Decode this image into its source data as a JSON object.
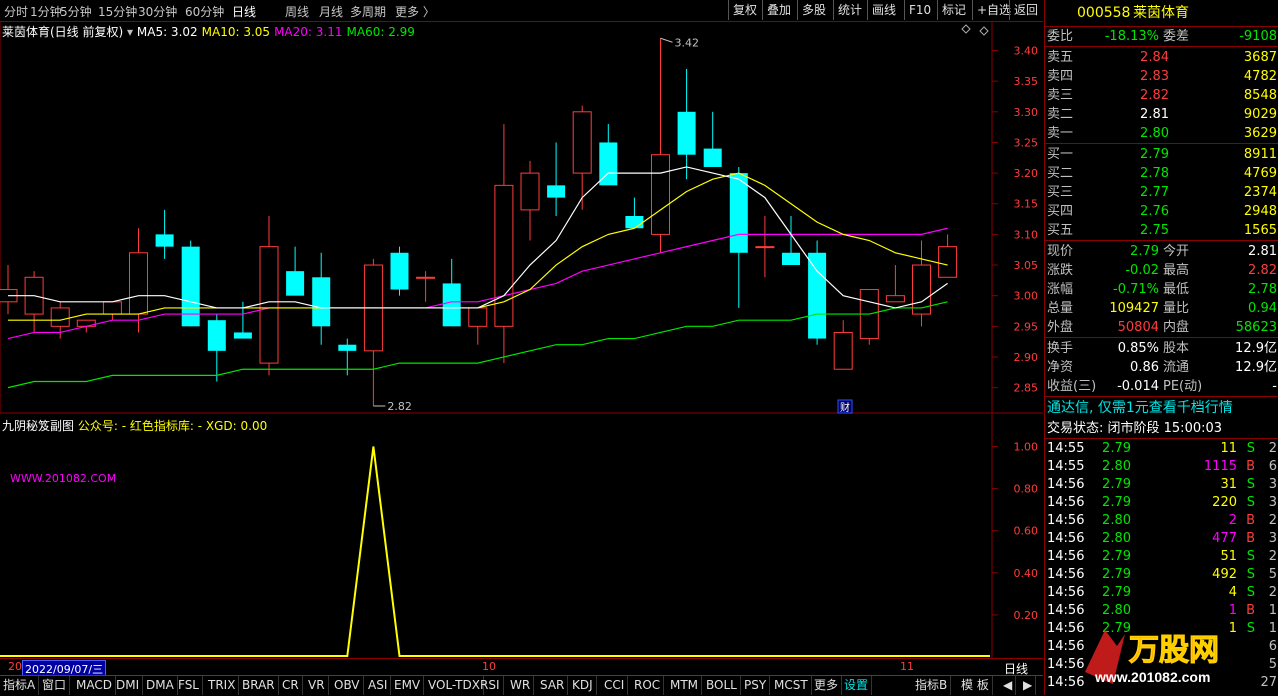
{
  "toolbar": {
    "periods": [
      "分时",
      "1分钟",
      "5分钟",
      "15分钟",
      "30分钟",
      "60分钟",
      "日线",
      "周线",
      "月线",
      "多周期",
      "更多 〉"
    ],
    "active_period": "日线",
    "right_buttons": [
      "复权",
      "叠加",
      "多股",
      "统计",
      "画线",
      "F10",
      "标记",
      "+自选",
      "返回"
    ]
  },
  "main_chart": {
    "title": "莱茵体育(日线 前复权)",
    "dropdown": "▾",
    "ma_labels": [
      {
        "text": "MA5: 3.02",
        "color": "#ffffff"
      },
      {
        "text": "MA10: 3.05",
        "color": "#ffff00"
      },
      {
        "text": "MA20: 3.11",
        "color": "#ff00ff"
      },
      {
        "text": "MA60: 2.99",
        "color": "#00e600"
      }
    ],
    "high_marker": "3.42",
    "low_marker": "2.82",
    "fin_badge": "财",
    "y_ticks": [
      "3.40",
      "3.35",
      "3.30",
      "3.25",
      "3.20",
      "3.15",
      "3.10",
      "3.05",
      "3.00",
      "2.95",
      "2.90",
      "2.85"
    ]
  },
  "sub_chart": {
    "title": "九阴秘笈副图",
    "wechat_label": "公众号: -",
    "indicator_lib": "红色指标库: -",
    "xgd": "XGD: 0.00",
    "watermark": "WWW.201082.COM",
    "y_ticks": [
      "1.00",
      "0.80",
      "0.60",
      "0.40",
      "0.20"
    ]
  },
  "x_axis": {
    "date_label": "2022/09/07/三",
    "left_stub": "20",
    "month_ticks": [
      "10",
      "11"
    ],
    "period_label": "日线"
  },
  "bottom_tabs": [
    "指标A",
    "窗口",
    "MACD",
    "DMI",
    "DMA",
    "FSL",
    "TRIX",
    "BRAR",
    "CR",
    "VR",
    "OBV",
    "ASI",
    "EMV",
    "VOL-TDX",
    "RSI",
    "WR",
    "SAR",
    "KDJ",
    "CCI",
    "ROC",
    "MTM",
    "BOLL",
    "PSY",
    "MCST",
    "更多",
    "设置"
  ],
  "bottom_right_tabs": [
    "指标B",
    "模 板"
  ],
  "panel": {
    "code": "000558",
    "name": "莱茵体育",
    "weibi_label": "委比",
    "weibi": "-18.13%",
    "weicha_label": "委差",
    "weicha": "-9108",
    "asks": [
      {
        "label": "卖五",
        "price": "2.84",
        "vol": "3687"
      },
      {
        "label": "卖四",
        "price": "2.83",
        "vol": "4782"
      },
      {
        "label": "卖三",
        "price": "2.82",
        "vol": "8548"
      },
      {
        "label": "卖二",
        "price": "2.81",
        "vol": "9029"
      },
      {
        "label": "卖一",
        "price": "2.80",
        "vol": "3629"
      }
    ],
    "bids": [
      {
        "label": "买一",
        "price": "2.79",
        "vol": "8911"
      },
      {
        "label": "买二",
        "price": "2.78",
        "vol": "4769"
      },
      {
        "label": "买三",
        "price": "2.77",
        "vol": "2374"
      },
      {
        "label": "买四",
        "price": "2.76",
        "vol": "2948"
      },
      {
        "label": "买五",
        "price": "2.75",
        "vol": "1565"
      }
    ],
    "quote": [
      {
        "l1": "现价",
        "v1": "2.79",
        "l2": "今开",
        "v2": "2.81"
      },
      {
        "l1": "涨跌",
        "v1": "-0.02",
        "l2": "最高",
        "v2": "2.82"
      },
      {
        "l1": "涨幅",
        "v1": "-0.71%",
        "l2": "最低",
        "v2": "2.78"
      },
      {
        "l1": "总量",
        "v1": "109427",
        "l2": "量比",
        "v2": "0.94"
      },
      {
        "l1": "外盘",
        "v1": "50804",
        "l2": "内盘",
        "v2": "58623"
      }
    ],
    "fin": [
      {
        "l1": "换手",
        "v1": "0.85%",
        "l2": "股本",
        "v2": "12.9亿"
      },
      {
        "l1": "净资",
        "v1": "0.86",
        "l2": "流通",
        "v2": "12.9亿"
      },
      {
        "l1": "收益(三)",
        "v1": "-0.014",
        "l2": "PE(动)",
        "v2": "-"
      }
    ],
    "ad": "通达信, 仅需1元查看千档行情",
    "status": "交易状态: 闭市阶段 15:00:03",
    "ticks": [
      {
        "t": "14:55",
        "p": "2.79",
        "v": "11",
        "d": "S",
        "n": "2"
      },
      {
        "t": "14:55",
        "p": "2.80",
        "v": "1115",
        "d": "B",
        "n": "6"
      },
      {
        "t": "14:56",
        "p": "2.79",
        "v": "31",
        "d": "S",
        "n": "3"
      },
      {
        "t": "14:56",
        "p": "2.79",
        "v": "220",
        "d": "S",
        "n": "3"
      },
      {
        "t": "14:56",
        "p": "2.80",
        "v": "2",
        "d": "B",
        "n": "2"
      },
      {
        "t": "14:56",
        "p": "2.80",
        "v": "477",
        "d": "B",
        "n": "3"
      },
      {
        "t": "14:56",
        "p": "2.79",
        "v": "51",
        "d": "S",
        "n": "2"
      },
      {
        "t": "14:56",
        "p": "2.79",
        "v": "492",
        "d": "S",
        "n": "5"
      },
      {
        "t": "14:56",
        "p": "2.79",
        "v": "4",
        "d": "S",
        "n": "2"
      },
      {
        "t": "14:56",
        "p": "2.80",
        "v": "1",
        "d": "B",
        "n": "1"
      },
      {
        "t": "14:56",
        "p": "2.79",
        "v": "1",
        "d": "S",
        "n": "1"
      },
      {
        "t": "14:56",
        "p": "",
        "v": "",
        "d": "",
        "n": "6"
      },
      {
        "t": "14:56",
        "p": "",
        "v": "",
        "d": "",
        "n": "5"
      },
      {
        "t": "14:56",
        "p": "",
        "v": "",
        "d": "",
        "n": "27"
      }
    ],
    "logo_text": "万股网",
    "logo_url_text": "www.201082.com"
  },
  "chart_data": {
    "type": "candlestick",
    "ylim": [
      2.82,
      3.44
    ],
    "candles": [
      {
        "o": 2.99,
        "h": 3.05,
        "l": 2.97,
        "c": 3.01
      },
      {
        "o": 2.97,
        "h": 3.04,
        "l": 2.94,
        "c": 3.03
      },
      {
        "o": 2.95,
        "h": 2.99,
        "l": 2.93,
        "c": 2.98
      },
      {
        "o": 2.95,
        "h": 2.96,
        "l": 2.94,
        "c": 2.96
      },
      {
        "o": 2.97,
        "h": 2.99,
        "l": 2.96,
        "c": 2.99
      },
      {
        "o": 2.97,
        "h": 3.11,
        "l": 2.94,
        "c": 3.07
      },
      {
        "o": 3.1,
        "h": 3.14,
        "l": 3.06,
        "c": 3.08
      },
      {
        "o": 3.08,
        "h": 3.09,
        "l": 2.95,
        "c": 2.95
      },
      {
        "o": 2.96,
        "h": 2.97,
        "l": 2.86,
        "c": 2.91
      },
      {
        "o": 2.94,
        "h": 2.99,
        "l": 2.93,
        "c": 2.93
      },
      {
        "o": 2.89,
        "h": 3.13,
        "l": 2.87,
        "c": 3.08
      },
      {
        "o": 3.04,
        "h": 3.08,
        "l": 3.02,
        "c": 3.0
      },
      {
        "o": 3.03,
        "h": 3.07,
        "l": 2.92,
        "c": 2.95
      },
      {
        "o": 2.92,
        "h": 2.93,
        "l": 2.87,
        "c": 2.91
      },
      {
        "o": 2.91,
        "h": 3.06,
        "l": 2.82,
        "c": 3.05
      },
      {
        "o": 3.07,
        "h": 3.08,
        "l": 3.0,
        "c": 3.01
      },
      {
        "o": 3.03,
        "h": 3.04,
        "l": 2.99,
        "c": 3.03
      },
      {
        "o": 3.02,
        "h": 3.06,
        "l": 2.95,
        "c": 2.95
      },
      {
        "o": 2.95,
        "h": 2.97,
        "l": 2.92,
        "c": 2.98
      },
      {
        "o": 2.95,
        "h": 3.28,
        "l": 2.89,
        "c": 3.18
      },
      {
        "o": 3.14,
        "h": 3.22,
        "l": 3.09,
        "c": 3.2
      },
      {
        "o": 3.18,
        "h": 3.25,
        "l": 3.13,
        "c": 3.16
      },
      {
        "o": 3.2,
        "h": 3.31,
        "l": 3.14,
        "c": 3.3
      },
      {
        "o": 3.25,
        "h": 3.28,
        "l": 3.19,
        "c": 3.18
      },
      {
        "o": 3.13,
        "h": 3.16,
        "l": 3.11,
        "c": 3.11
      },
      {
        "o": 3.1,
        "h": 3.42,
        "l": 3.07,
        "c": 3.23
      },
      {
        "o": 3.3,
        "h": 3.37,
        "l": 3.19,
        "c": 3.23
      },
      {
        "o": 3.24,
        "h": 3.3,
        "l": 3.21,
        "c": 3.21
      },
      {
        "o": 3.2,
        "h": 3.21,
        "l": 2.98,
        "c": 3.07
      },
      {
        "o": 3.08,
        "h": 3.13,
        "l": 3.03,
        "c": 3.08
      },
      {
        "o": 3.07,
        "h": 3.13,
        "l": 3.05,
        "c": 3.05
      },
      {
        "o": 3.07,
        "h": 3.09,
        "l": 2.92,
        "c": 2.93
      },
      {
        "o": 2.88,
        "h": 2.96,
        "l": 2.88,
        "c": 2.94
      },
      {
        "o": 2.93,
        "h": 3.01,
        "l": 2.92,
        "c": 3.01
      },
      {
        "o": 2.99,
        "h": 3.05,
        "l": 2.99,
        "c": 3.0
      },
      {
        "o": 2.97,
        "h": 3.09,
        "l": 2.95,
        "c": 3.05
      },
      {
        "o": 3.03,
        "h": 3.1,
        "l": 3.03,
        "c": 3.08
      }
    ],
    "ma5": [
      3.0,
      3.0,
      2.99,
      2.99,
      2.99,
      3.0,
      3.0,
      2.99,
      2.98,
      2.98,
      2.99,
      2.99,
      2.98,
      2.98,
      2.98,
      2.98,
      2.98,
      2.98,
      2.98,
      3.0,
      3.05,
      3.09,
      3.16,
      3.2,
      3.2,
      3.2,
      3.21,
      3.2,
      3.19,
      3.16,
      3.1,
      3.04,
      3.0,
      2.99,
      2.98,
      2.99,
      3.02
    ],
    "ma10": [
      2.96,
      2.96,
      2.96,
      2.97,
      2.97,
      2.97,
      2.98,
      2.98,
      2.98,
      2.98,
      2.98,
      2.98,
      2.98,
      2.98,
      2.98,
      2.98,
      2.98,
      2.98,
      2.98,
      2.99,
      3.01,
      3.05,
      3.08,
      3.1,
      3.11,
      3.14,
      3.17,
      3.19,
      3.2,
      3.18,
      3.15,
      3.12,
      3.1,
      3.09,
      3.07,
      3.06,
      3.05
    ],
    "ma20": [
      2.93,
      2.94,
      2.94,
      2.95,
      2.96,
      2.96,
      2.97,
      2.97,
      2.97,
      2.97,
      2.98,
      2.98,
      2.98,
      2.98,
      2.98,
      2.98,
      2.98,
      2.99,
      2.99,
      3.0,
      3.01,
      3.02,
      3.04,
      3.05,
      3.06,
      3.07,
      3.08,
      3.09,
      3.1,
      3.1,
      3.1,
      3.1,
      3.1,
      3.1,
      3.1,
      3.1,
      3.11
    ],
    "ma60": [
      2.85,
      2.86,
      2.86,
      2.86,
      2.87,
      2.87,
      2.87,
      2.87,
      2.87,
      2.88,
      2.88,
      2.88,
      2.88,
      2.88,
      2.88,
      2.89,
      2.89,
      2.89,
      2.89,
      2.9,
      2.91,
      2.92,
      2.92,
      2.93,
      2.93,
      2.94,
      2.95,
      2.95,
      2.96,
      2.96,
      2.96,
      2.97,
      2.97,
      2.97,
      2.98,
      2.98,
      2.99
    ],
    "sub_line": {
      "ylim": [
        0,
        1.05
      ],
      "spike_index": 14,
      "spike_value": 1.0
    }
  }
}
